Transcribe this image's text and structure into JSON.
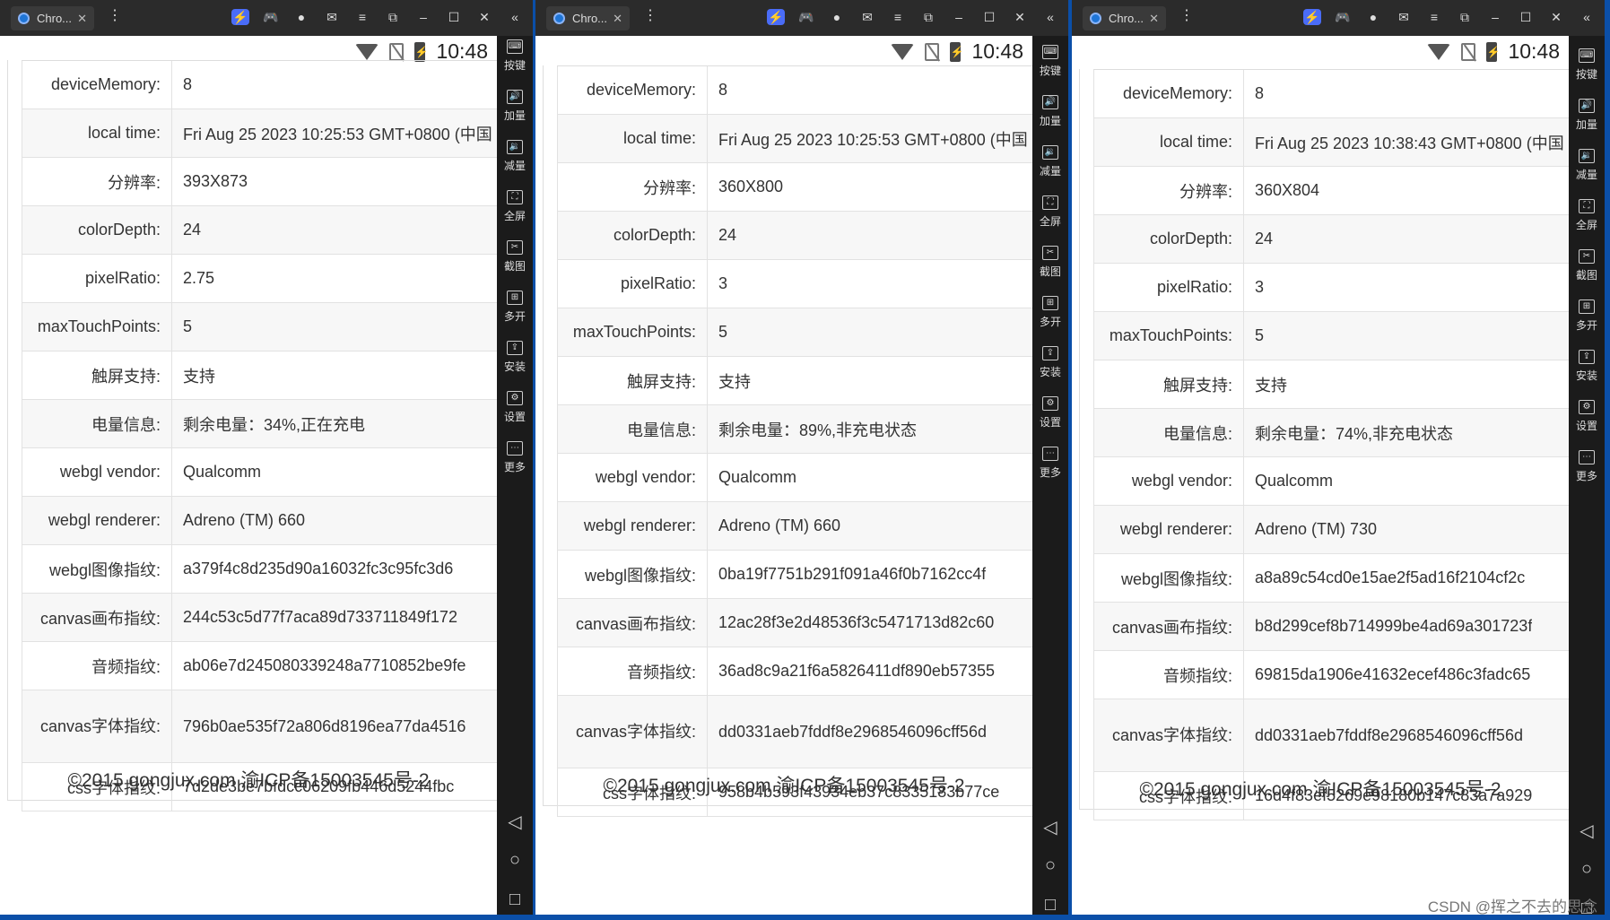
{
  "sidebar_labels": [
    "按键",
    "加量",
    "减量",
    "全屏",
    "截图",
    "多开",
    "安装",
    "设置",
    "更多"
  ],
  "status_time": "10:48",
  "footer": "©2015 gongjux.com 渝ICP备15003545号-2",
  "watermark": "CSDN @挥之不去的思念",
  "windows": [
    {
      "tab": "Chro...",
      "rows": [
        {
          "k": "deviceMemory:",
          "v": "8"
        },
        {
          "k": "local time:",
          "v": "Fri Aug 25 2023 10:25:53 GMT+0800 (中国"
        },
        {
          "k": "分辨率:",
          "v": "393X873"
        },
        {
          "k": "colorDepth:",
          "v": "24"
        },
        {
          "k": "pixelRatio:",
          "v": "2.75"
        },
        {
          "k": "maxTouchPoints:",
          "v": "5"
        },
        {
          "k": "触屏支持:",
          "v": "支持"
        },
        {
          "k": "电量信息:",
          "v": "剩余电量：34%,正在充电"
        },
        {
          "k": "webgl vendor:",
          "v": "Qualcomm"
        },
        {
          "k": "webgl renderer:",
          "v": "Adreno (TM) 660"
        },
        {
          "k": "webgl图像指纹:",
          "v": "a379f4c8d235d90a16032fc3c95fc3d6"
        },
        {
          "k": "canvas画布指纹:",
          "v": "244c53c5d77f7aca89d733711849f172"
        },
        {
          "k": "音频指纹:",
          "v": "ab06e7d245080339248a7710852be9fe"
        },
        {
          "k": "canvas字体指纹:",
          "v": "796b0ae535f72a806d8196ea77da4516"
        },
        {
          "k": "css字体指纹:",
          "v": "7d2de3be7bfdcc06209fb446d5244fbc"
        }
      ]
    },
    {
      "tab": "Chro...",
      "rows": [
        {
          "k": "deviceMemory:",
          "v": "8"
        },
        {
          "k": "local time:",
          "v": "Fri Aug 25 2023 10:25:53 GMT+0800 (中国"
        },
        {
          "k": "分辨率:",
          "v": "360X800"
        },
        {
          "k": "colorDepth:",
          "v": "24"
        },
        {
          "k": "pixelRatio:",
          "v": "3"
        },
        {
          "k": "maxTouchPoints:",
          "v": "5"
        },
        {
          "k": "触屏支持:",
          "v": "支持"
        },
        {
          "k": "电量信息:",
          "v": "剩余电量：89%,非充电状态"
        },
        {
          "k": "webgl vendor:",
          "v": "Qualcomm"
        },
        {
          "k": "webgl renderer:",
          "v": "Adreno (TM) 660"
        },
        {
          "k": "webgl图像指纹:",
          "v": "0ba19f7751b291f091a46f0b7162cc4f"
        },
        {
          "k": "canvas画布指纹:",
          "v": "12ac28f3e2d48536f3c5471713d82c60"
        },
        {
          "k": "音频指纹:",
          "v": "36ad8c9a21f6a5826411df890eb57355"
        },
        {
          "k": "canvas字体指纹:",
          "v": "dd0331aeb7fddf8e2968546096cff56d"
        },
        {
          "k": "css字体指纹:",
          "v": "958b4b593f43934eb37c8335183b77ce"
        }
      ]
    },
    {
      "tab": "Chro...",
      "rows": [
        {
          "k": "deviceMemory:",
          "v": "8"
        },
        {
          "k": "local time:",
          "v": "Fri Aug 25 2023 10:38:43 GMT+0800 (中国"
        },
        {
          "k": "分辨率:",
          "v": "360X804"
        },
        {
          "k": "colorDepth:",
          "v": "24"
        },
        {
          "k": "pixelRatio:",
          "v": "3"
        },
        {
          "k": "maxTouchPoints:",
          "v": "5"
        },
        {
          "k": "触屏支持:",
          "v": "支持"
        },
        {
          "k": "电量信息:",
          "v": "剩余电量：74%,非充电状态"
        },
        {
          "k": "webgl vendor:",
          "v": "Qualcomm"
        },
        {
          "k": "webgl renderer:",
          "v": "Adreno (TM) 730"
        },
        {
          "k": "webgl图像指纹:",
          "v": "a8a89c54cd0e15ae2f5ad16f2104cf2c"
        },
        {
          "k": "canvas画布指纹:",
          "v": "b8d299cef8b714999be4ad69a301723f"
        },
        {
          "k": "音频指纹:",
          "v": "69815da1906e41632ecef486c3fadc65"
        },
        {
          "k": "canvas字体指纹:",
          "v": "dd0331aeb7fddf8e2968546096cff56d"
        },
        {
          "k": "css字体指纹:",
          "v": "16d4f83ef5269e98180b147c83a7a929"
        }
      ]
    }
  ]
}
